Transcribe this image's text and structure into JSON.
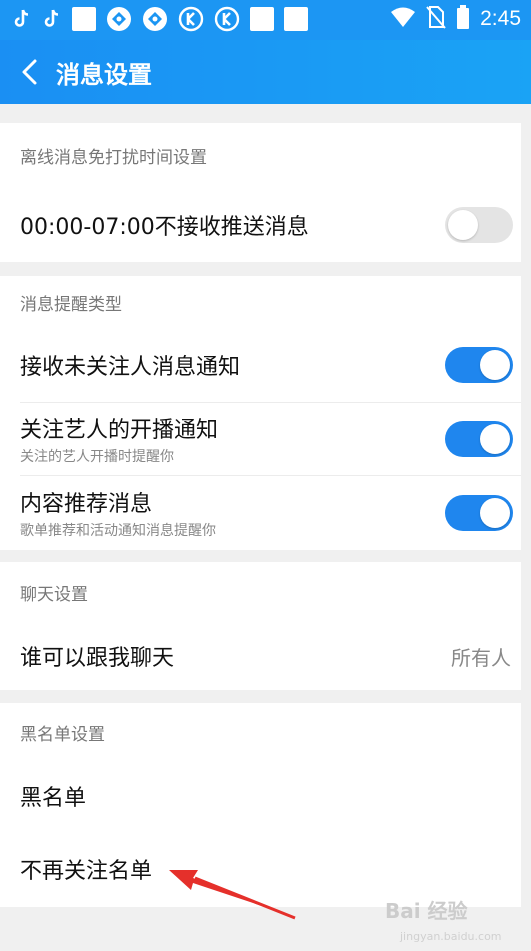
{
  "status_bar": {
    "time": "2:45",
    "icons": [
      "tiktok-icon",
      "tiktok-icon",
      "white-square-icon",
      "app-icon",
      "app-icon",
      "kugou-icon",
      "kugou-icon",
      "white-square-icon",
      "white-square-icon",
      "wifi-icon",
      "no-sim-icon",
      "battery-icon"
    ]
  },
  "header": {
    "title": "消息设置"
  },
  "sections": {
    "offline": {
      "label": "离线消息免打扰时间设置",
      "dnd_label": "00:00-07:00不接收推送消息",
      "dnd_on": false
    },
    "remind": {
      "label": "消息提醒类型",
      "unfollowed_label": "接收未关注人消息通知",
      "unfollowed_on": true,
      "live_label": "关注艺人的开播通知",
      "live_sub": "关注的艺人开播时提醒你",
      "live_on": true,
      "recommend_label": "内容推荐消息",
      "recommend_sub": "歌单推荐和活动通知消息提醒你",
      "recommend_on": true
    },
    "chat": {
      "label": "聊天设置",
      "who_label": "谁可以跟我聊天",
      "who_value": "所有人"
    },
    "blacklist": {
      "label": "黑名单设置",
      "blacklist_label": "黑名单",
      "unfollow_label": "不再关注名单"
    }
  },
  "watermark": {
    "text": "Bai 经验",
    "sub": "jingyan.baidu.com"
  },
  "colors": {
    "accent": "#1f86ee",
    "header": "#1a96f3",
    "annotation": "#e5302b"
  }
}
